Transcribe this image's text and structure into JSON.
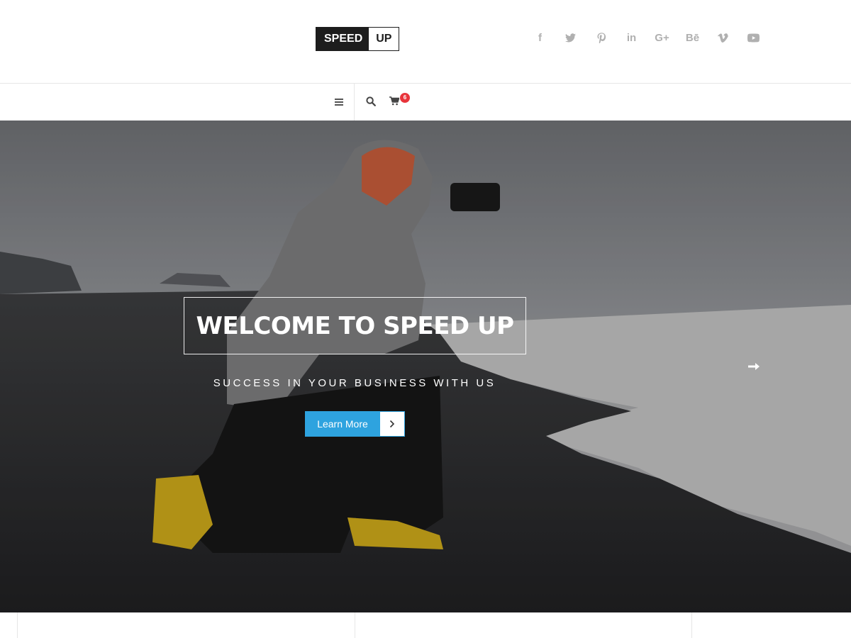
{
  "logo": {
    "part1": "SPEED",
    "part2": "UP"
  },
  "social": [
    {
      "name": "facebook-icon",
      "glyph": "f"
    },
    {
      "name": "twitter-icon",
      "glyph": ""
    },
    {
      "name": "pinterest-icon",
      "glyph": ""
    },
    {
      "name": "linkedin-icon",
      "glyph": "in"
    },
    {
      "name": "google-plus-icon",
      "glyph": "G+"
    },
    {
      "name": "behance-icon",
      "glyph": "Bē"
    },
    {
      "name": "vimeo-icon",
      "glyph": ""
    },
    {
      "name": "youtube-icon",
      "glyph": ""
    }
  ],
  "nav": {
    "cart_count": "6"
  },
  "hero": {
    "title": "WELCOME TO SPEED UP",
    "subtitle": "SUCCESS IN YOUR BUSINESS WITH US",
    "cta_label": "Learn More"
  },
  "colors": {
    "accent": "#2ea3df",
    "badge": "#e8343b",
    "logo_dark": "#1d1d1d",
    "icon_gray": "#b0b0b0"
  }
}
